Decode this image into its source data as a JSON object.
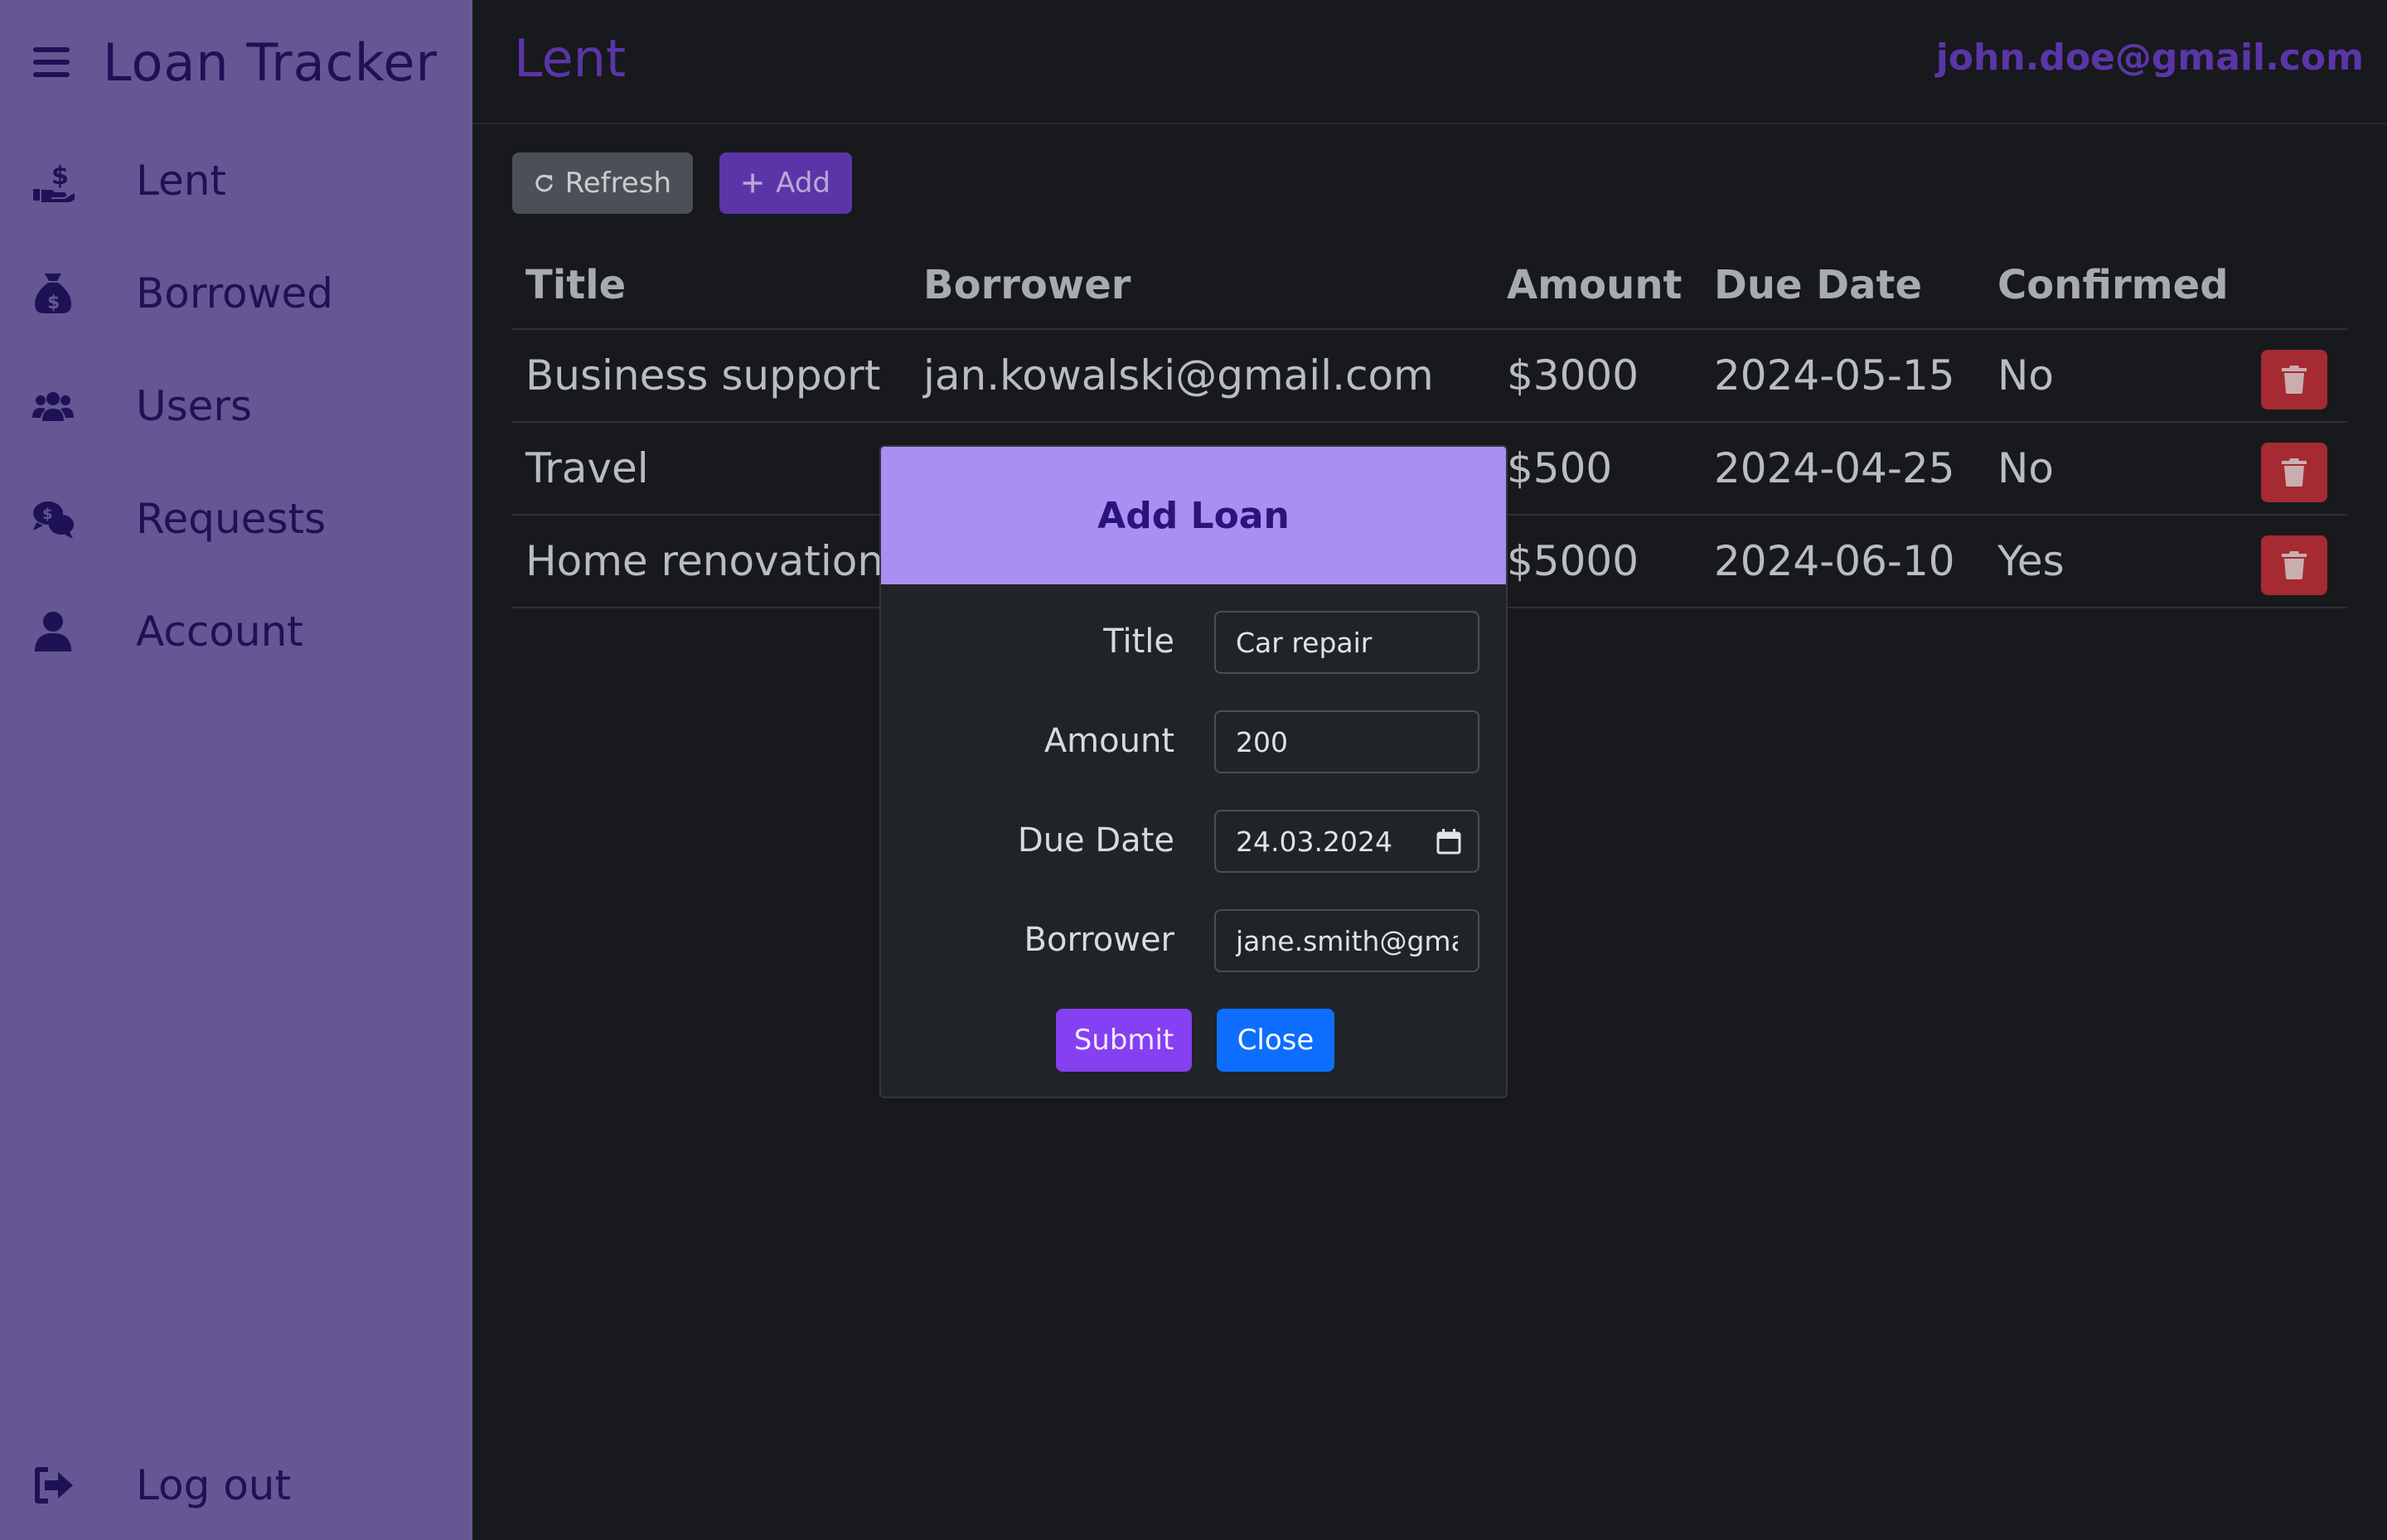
{
  "app": {
    "title": "Loan Tracker"
  },
  "sidebar": {
    "items": [
      {
        "label": "Lent",
        "icon": "hand-holding-dollar-icon"
      },
      {
        "label": "Borrowed",
        "icon": "money-bag-icon"
      },
      {
        "label": "Users",
        "icon": "users-icon"
      },
      {
        "label": "Requests",
        "icon": "comments-dollar-icon"
      },
      {
        "label": "Account",
        "icon": "user-icon"
      }
    ],
    "logout": {
      "label": "Log out",
      "icon": "logout-icon"
    }
  },
  "header": {
    "title": "Lent",
    "user_email": "john.doe@gmail.com"
  },
  "toolbar": {
    "refresh_label": "Refresh",
    "add_label": "Add"
  },
  "table": {
    "columns": [
      "Title",
      "Borrower",
      "Amount",
      "Due Date",
      "Confirmed"
    ],
    "rows": [
      {
        "title": "Business support",
        "borrower": "jan.kowalski@gmail.com",
        "amount": "$3000",
        "due": "2024-05-15",
        "confirmed": "No"
      },
      {
        "title": "Travel",
        "borrower": "",
        "amount": "$500",
        "due": "2024-04-25",
        "confirmed": "No"
      },
      {
        "title": "Home renovation",
        "borrower": "",
        "amount": "$5000",
        "due": "2024-06-10",
        "confirmed": "Yes"
      }
    ]
  },
  "modal": {
    "title": "Add Loan",
    "fields": {
      "title": {
        "label": "Title",
        "value": "Car repair"
      },
      "amount": {
        "label": "Amount",
        "value": "200"
      },
      "due_date": {
        "label": "Due Date",
        "value": "24.03.2024"
      },
      "borrower": {
        "label": "Borrower",
        "value": "jane.smith@gmail.com"
      }
    },
    "submit_label": "Submit",
    "close_label": "Close"
  },
  "colors": {
    "sidebar_bg": "#675694",
    "accent": "#5b35a8",
    "modal_header": "#a98ff1",
    "danger": "#a52a31",
    "submit": "#8540f1",
    "close": "#0d6efd"
  }
}
